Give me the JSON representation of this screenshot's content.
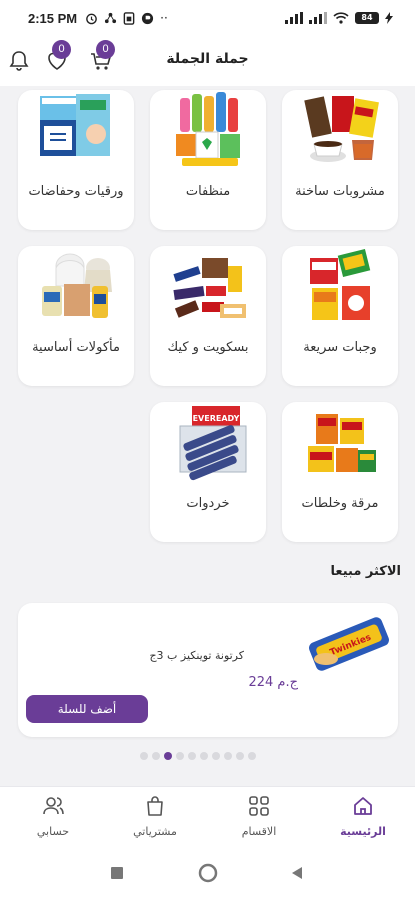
{
  "status_bar": {
    "time": "2:15 PM",
    "battery": "84",
    "icons": [
      "alarm-icon",
      "share-icon",
      "sim-icon",
      "app-icon",
      "more-icon",
      "signal-icon",
      "wifi-icon",
      "battery-icon",
      "charging-icon"
    ]
  },
  "header": {
    "title": "جملة الجملة",
    "cart_count": "0",
    "favorites_count": "0",
    "icons": [
      "bell-icon",
      "heart-icon",
      "cart-icon"
    ]
  },
  "categories": [
    {
      "label": "مشروبات ساخنة",
      "icon": "hot-drinks-image"
    },
    {
      "label": "منظفات",
      "icon": "cleaners-image"
    },
    {
      "label": "ورقيات وحفاضات",
      "icon": "paper-diapers-image"
    },
    {
      "label": "وجبات سريعة",
      "icon": "fast-food-image"
    },
    {
      "label": "بسكويت و كيك",
      "icon": "biscuits-cake-image"
    },
    {
      "label": "مأكولات أساسية",
      "icon": "staples-image"
    },
    {
      "label": "مرقة وخلطات",
      "icon": "broth-mixes-image"
    },
    {
      "label": "خردوات",
      "icon": "batteries-image",
      "brand_text": "EVEREADY"
    }
  ],
  "best_sellers": {
    "title": "الاكثر مبيعا",
    "product": {
      "name": "كرتونة توينكيز ب 3ج",
      "price": "224 ج.م",
      "add_button": "أضف للسلة",
      "brand_text": "Twinkies"
    },
    "carousel": {
      "count": 10,
      "active_index": 2
    }
  },
  "bottom_nav": {
    "items": [
      {
        "label": "الرئيسية",
        "icon": "home-icon",
        "active": true
      },
      {
        "label": "الاقسام",
        "icon": "grid-icon",
        "active": false
      },
      {
        "label": "مشترياتي",
        "icon": "shopping-bag-icon",
        "active": false
      },
      {
        "label": "حسابي",
        "icon": "user-icon",
        "active": false
      }
    ]
  },
  "colors": {
    "accent": "#6a3d97",
    "background": "#f2f2f4",
    "card": "#ffffff"
  }
}
